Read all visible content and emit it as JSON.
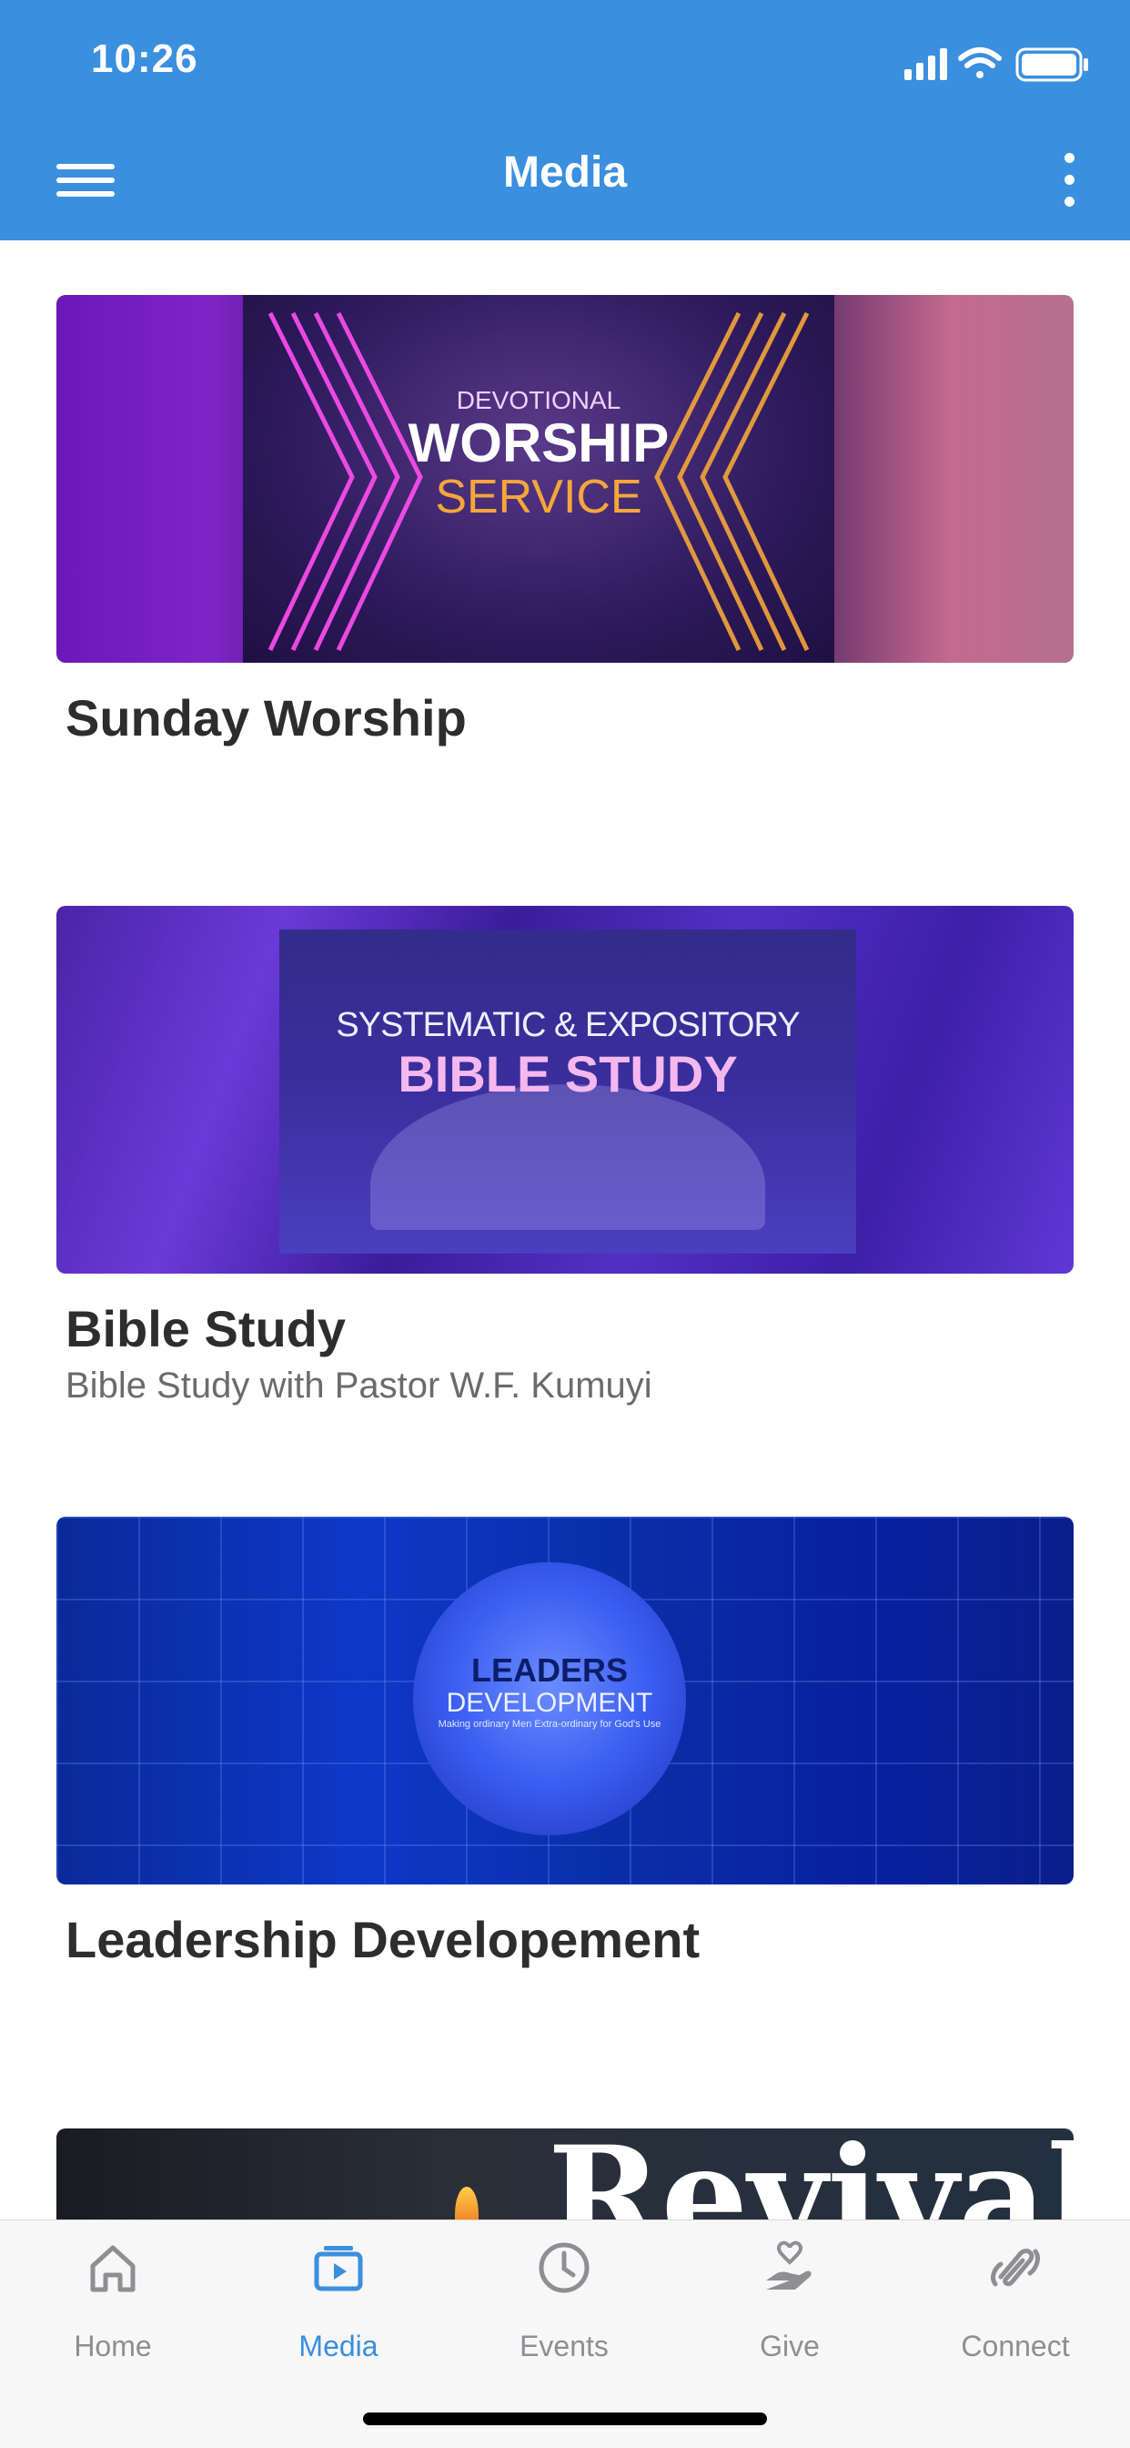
{
  "status_bar": {
    "time": "10:26",
    "icons": [
      "signal-icon",
      "wifi-icon",
      "battery-icon"
    ]
  },
  "nav": {
    "title": "Media",
    "menu_icon": "hamburger-menu-icon",
    "more_icon": "more-vertical-icon"
  },
  "colors": {
    "header_bg": "#3a8fde",
    "active_tab": "#3a8fde",
    "inactive_tab": "#8e8e93"
  },
  "media": [
    {
      "title": "Sunday Worship",
      "subtitle": "",
      "thumbnail_text": {
        "line1": "DEVOTIONAL",
        "line2": "WORSHIP",
        "line3": "SERVICE"
      }
    },
    {
      "title": "Bible Study",
      "subtitle": "Bible Study with Pastor W.F. Kumuyi",
      "thumbnail_text": {
        "line1": "SYSTEMATIC & EXPOSITORY",
        "line2": "BIBLE STUDY"
      }
    },
    {
      "title": "Leadership Developement",
      "subtitle": "",
      "thumbnail_text": {
        "line1": "LEADERS",
        "line2": "DEVELOPMENT",
        "line3": "Making ordinary Men Extra-ordinary for God's Use"
      }
    },
    {
      "title": "",
      "subtitle": "",
      "thumbnail_text": {
        "line1": "Revival"
      }
    }
  ],
  "tabs": [
    {
      "label": "Home",
      "icon": "home-icon",
      "active": false
    },
    {
      "label": "Media",
      "icon": "media-icon",
      "active": true
    },
    {
      "label": "Events",
      "icon": "clock-icon",
      "active": false
    },
    {
      "label": "Give",
      "icon": "give-hand-heart-icon",
      "active": false
    },
    {
      "label": "Connect",
      "icon": "connect-icon",
      "active": false
    }
  ]
}
